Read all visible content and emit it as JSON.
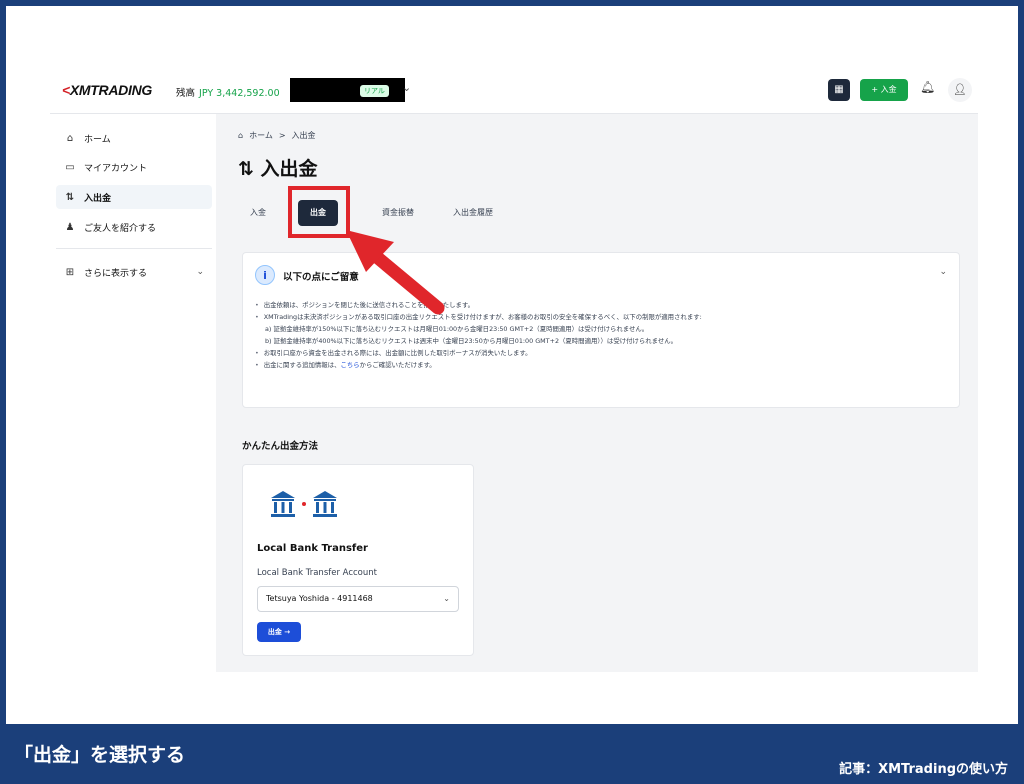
{
  "header": {
    "logo_text": "XMTRADING",
    "balance_label": "残高",
    "balance_value": "JPY 3,442,592.00",
    "account_type_badge": "リアル",
    "deposit_label": "+ 入金"
  },
  "sidebar": {
    "items": [
      {
        "label": "ホーム",
        "icon": "home-icon"
      },
      {
        "label": "マイアカウント",
        "icon": "card-icon"
      },
      {
        "label": "入出金",
        "icon": "transfer-arrows-icon"
      },
      {
        "label": "ご友人を紹介する",
        "icon": "people-icon"
      }
    ],
    "more_label": "さらに表示する"
  },
  "main": {
    "breadcrumb": {
      "home": "ホーム",
      "separator": ">",
      "current": "入出金"
    },
    "page_title": "入出金",
    "tabs": [
      {
        "label": "入金",
        "active": false
      },
      {
        "label": "出金",
        "active": true
      },
      {
        "label": "資金振替",
        "active": false
      },
      {
        "label": "入出金履歴",
        "active": false
      }
    ],
    "notice": {
      "title": "以下の点にご留意",
      "items": [
        "出金依頼は、ポジションを閉じた後に送信されることを推奨いたします。",
        "XMTradingは未決済ポジションがある取引口座の出金リクエストを受け付けますが、お客様のお取引の安全を確保するべく、以下の制限が適用されます:",
        "a) 証拠金維持率が150%以下に落ち込むリクエストは月曜日01:00から金曜日23:50 GMT+2（夏時間適用）は受け付けられません。",
        "b) 証拠金維持率が400%以下に落ち込むリクエストは週末中（金曜日23:50から月曜日01:00 GMT+2（夏時間適用））は受け付けられません。",
        "お取引口座から資金を出金される際には、出金額に比例した取引ボーナスが消失いたします。"
      ],
      "last_item_prefix": "出金に関する追加情報は、",
      "last_item_link": "こちら",
      "last_item_suffix": "からご確認いただけます。"
    },
    "section_title": "かんたん出金方法",
    "method": {
      "title": "Local Bank Transfer",
      "subtitle": "Local Bank Transfer Account",
      "selected_account": "Tetsuya Yoshida - 4911468",
      "button_label": "出金 →"
    }
  },
  "footer": {
    "caption": "「出金」を選択する",
    "article_credit": "記事：XMTradingの使い方"
  },
  "colors": {
    "frame_border": "#1b3f7a",
    "accent_green": "#16a34a",
    "active_tab": "#1e293b",
    "highlight_red": "#e0262b",
    "link_blue": "#1d4ed8"
  }
}
